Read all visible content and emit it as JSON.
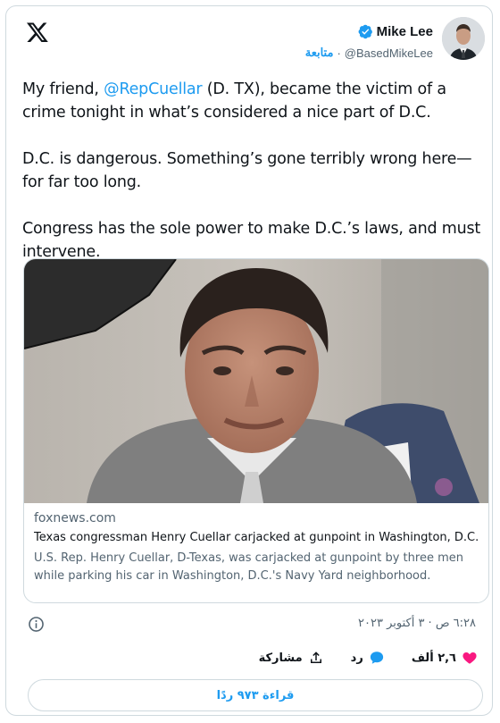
{
  "header": {
    "display_name": "Mike Lee",
    "handle": "@BasedMikeLee",
    "follow_label": "متابعة",
    "separator": "·"
  },
  "tweet": {
    "line1_prefix": "My friend, ",
    "mention": "@RepCuellar",
    "line1_suffix": " (D. TX), became the victim of a crime tonight in what’s considered a nice part of D.C.",
    "paragraph2": "D.C. is dangerous. Something’s gone terribly wrong here—for far too long.",
    "paragraph3": "Congress has the sole power to make D.C.’s laws, and must intervene."
  },
  "link_card": {
    "domain": "foxnews.com",
    "title": "Texas congressman Henry Cuellar carjacked at gunpoint in Washington, D.C.",
    "description": "U.S. Rep. Henry Cuellar, D-Texas, was carjacked at gunpoint by three men while parking his car in Washington, D.C.'s Navy Yard neighborhood."
  },
  "meta": {
    "timestamp": "٦:٢٨ ص · ٣ أكتوبر ٢٠٢٣"
  },
  "actions": {
    "like_count": "٢,٦ ألف",
    "reply_label": "رد",
    "share_label": "مشاركة"
  },
  "reply_button": {
    "label": "قراءة ٩٧٣ ردًا"
  },
  "colors": {
    "accent": "#1d9bf0",
    "like": "#f91880",
    "muted": "#536471",
    "text": "#0f1419"
  }
}
